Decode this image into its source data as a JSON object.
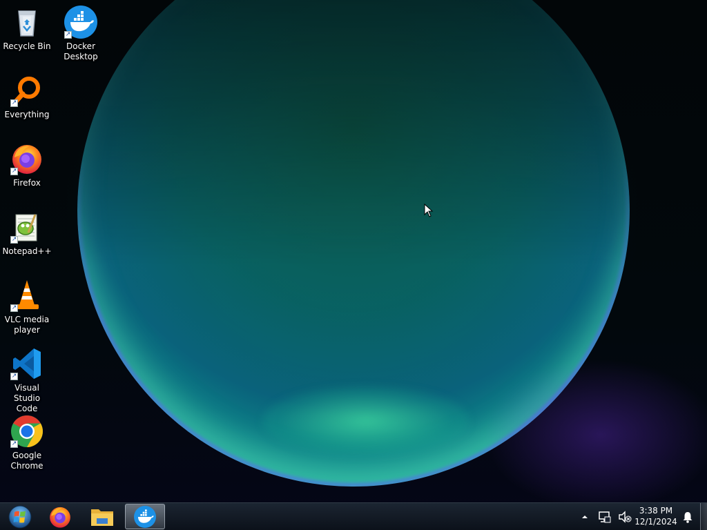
{
  "desktop": {
    "icons": [
      {
        "label": "Recycle Bin",
        "icon": "recycle-bin-icon",
        "shortcut": false
      },
      {
        "label": "Docker\nDesktop",
        "icon": "docker-icon",
        "shortcut": true
      },
      {
        "label": "Everything",
        "icon": "everything-search-icon",
        "shortcut": true
      },
      {
        "label": "Firefox",
        "icon": "firefox-icon",
        "shortcut": true
      },
      {
        "label": "Notepad++",
        "icon": "notepadpp-icon",
        "shortcut": true
      },
      {
        "label": "VLC media\nplayer",
        "icon": "vlc-icon",
        "shortcut": true
      },
      {
        "label": "Visual Studio\nCode",
        "icon": "vscode-icon",
        "shortcut": true
      },
      {
        "label": "Google\nChrome",
        "icon": "chrome-icon",
        "shortcut": true
      }
    ]
  },
  "taskbar": {
    "start_icon": "windows-start-icon",
    "pinned": [
      "firefox-icon",
      "file-explorer-icon",
      "docker-icon"
    ],
    "active_app": "Docker Desktop",
    "tray": {
      "icons": [
        "show-hidden-icons-icon",
        "network-icon",
        "volume-muted-icon",
        "notification-bell-icon"
      ],
      "time": "3:38 PM",
      "date": "12/1/2024"
    }
  },
  "colors": {
    "taskbar_bg": "#141c26",
    "docker_blue": "#1d91e6",
    "firefox_orange": "#ff6a1c",
    "vscode_blue": "#0e75c8",
    "chrome_red": "#e33b2e",
    "chrome_green": "#2fa44f",
    "chrome_yellow": "#f9c11b",
    "chrome_blue": "#1a73e8"
  }
}
